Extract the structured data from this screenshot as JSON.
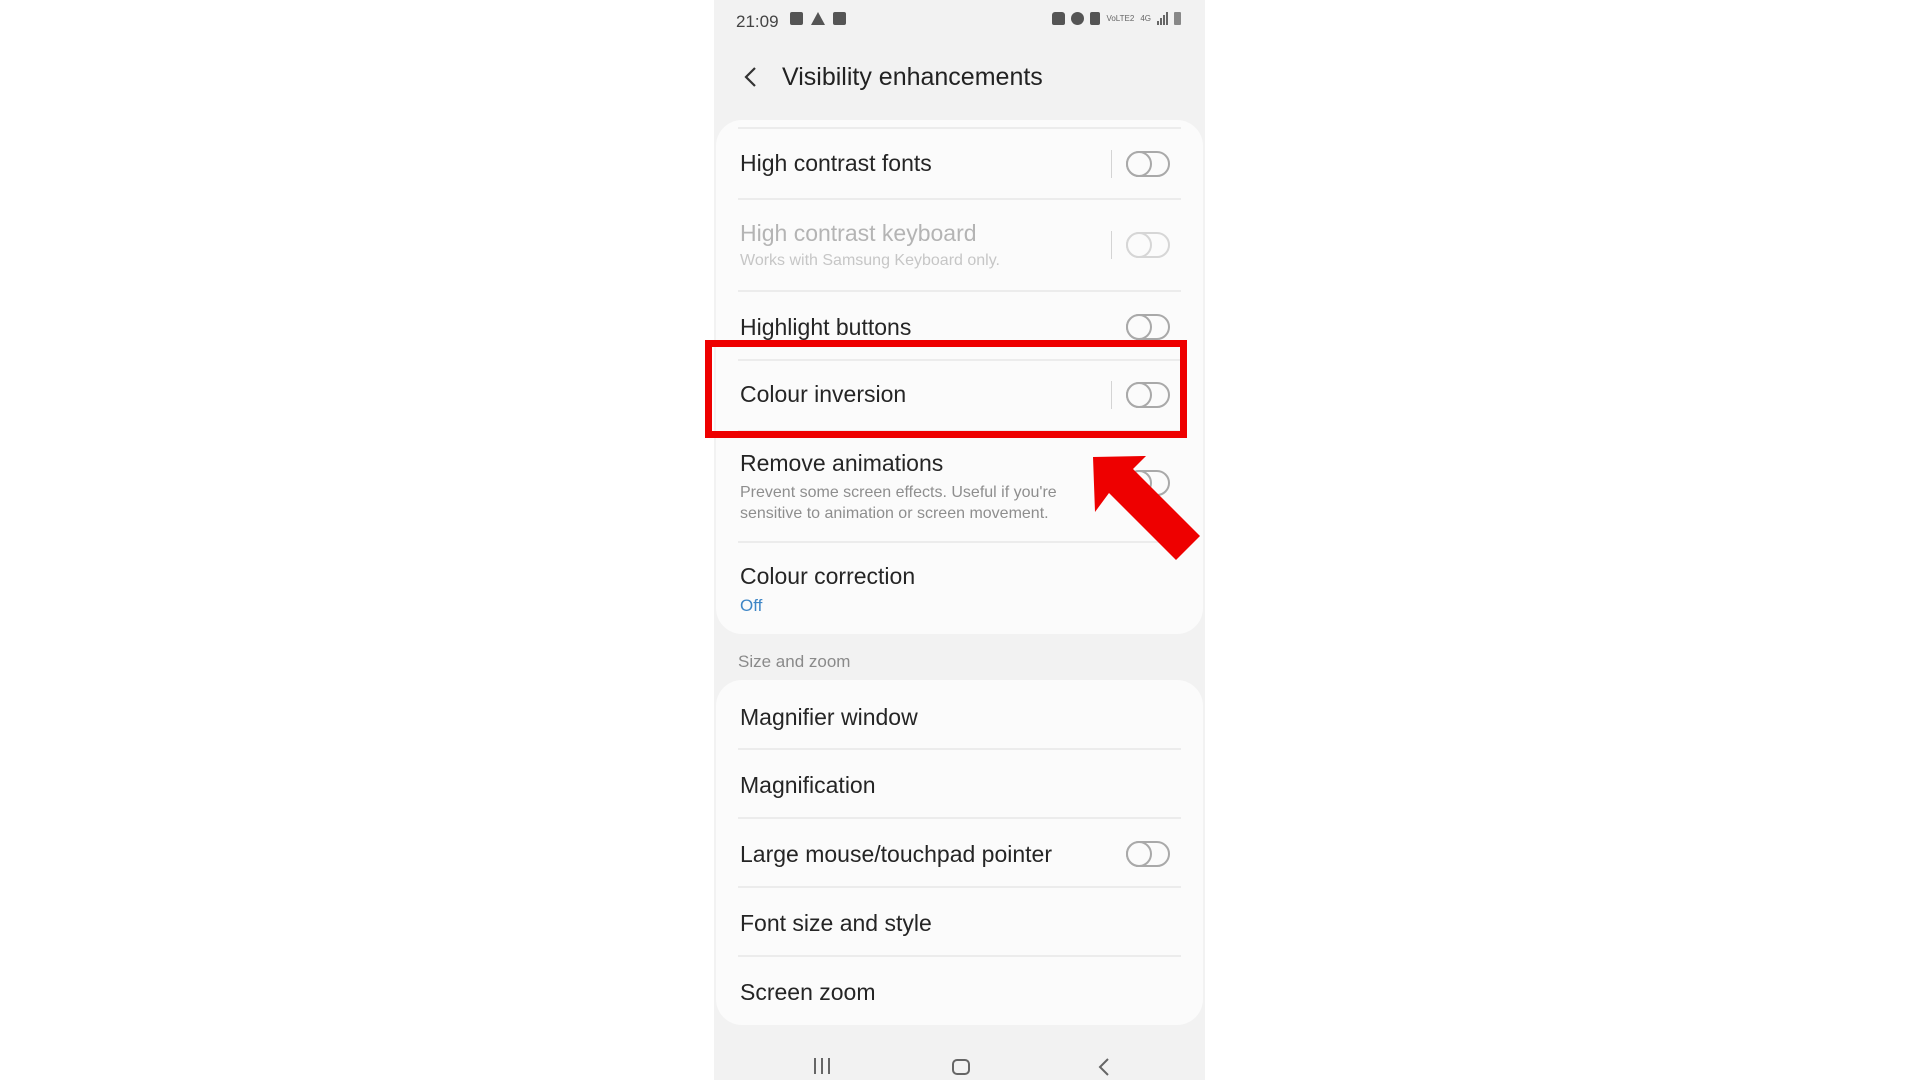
{
  "status_bar": {
    "time": "21:09",
    "left_icons": [
      "gallery-icon",
      "warning-icon",
      "checkbox-icon"
    ],
    "right_icons": [
      "lock-icon",
      "alarm-icon",
      "mute-icon",
      "volte-icon",
      "4g-icon",
      "signal-icon",
      "battery-icon"
    ],
    "volte_text": "VoLTE2",
    "network_text": "4G"
  },
  "header": {
    "back_icon": "chevron-left-icon",
    "title": "Visibility enhancements"
  },
  "visibility_settings": [
    {
      "label": "High contrast fonts",
      "toggle": "off",
      "enabled": true
    },
    {
      "label": "High contrast keyboard",
      "subtitle": "Works with Samsung Keyboard only.",
      "toggle": "off",
      "enabled": false
    },
    {
      "label": "Highlight buttons",
      "toggle": "off",
      "enabled": true
    },
    {
      "label": "Colour inversion",
      "toggle": "off",
      "enabled": true,
      "highlighted": true
    },
    {
      "label": "Remove animations",
      "subtitle": "Prevent some screen effects. Useful if you're sensitive to animation or screen movement.",
      "subtitle_line1": "Prevent some screen effects. Useful if you're",
      "subtitle_line2": "sensitive to animation or screen movement.",
      "toggle": "off",
      "enabled": true
    },
    {
      "label": "Colour correction",
      "subtitle": "Off",
      "enabled": true
    }
  ],
  "size_and_zoom": {
    "section_label": "Size and zoom",
    "items": [
      {
        "label": "Magnifier window"
      },
      {
        "label": "Magnification"
      },
      {
        "label": "Large mouse/touchpad pointer",
        "toggle": "off"
      },
      {
        "label": "Font size and style"
      },
      {
        "label": "Screen zoom"
      }
    ]
  },
  "nav_bar": {
    "buttons": [
      "recents-icon",
      "home-icon",
      "back-icon"
    ]
  },
  "annotation": {
    "highlight_target": "Colour inversion",
    "highlight_color": "#ee0000",
    "arrow_color": "#ee0000"
  },
  "colors": {
    "accent_blue": "#3e86c6",
    "background": "#f2f2f2",
    "card": "#fbfbfb"
  }
}
